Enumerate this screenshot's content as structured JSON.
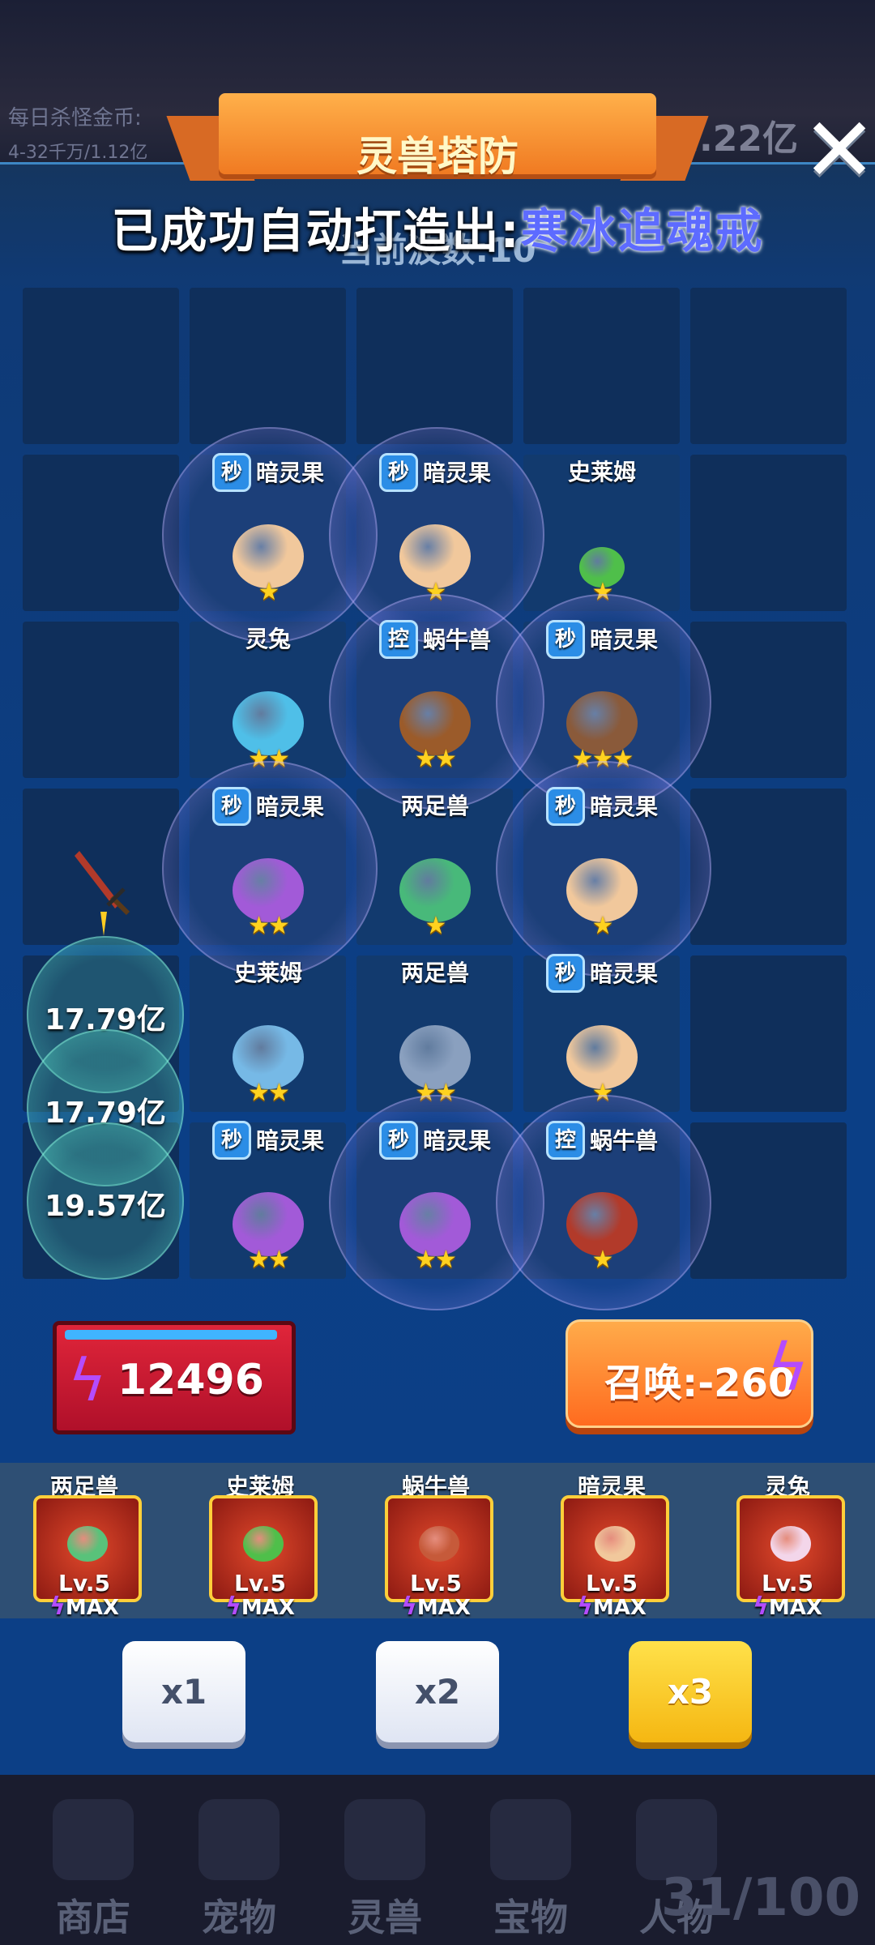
{
  "background": {
    "earnings_label": "每日杀怪金币:",
    "earnings_sub": "4-32千万/1.12亿",
    "gold_total": "2.22亿"
  },
  "header": {
    "title": "灵兽塔防",
    "wave_label": "当前波数:10",
    "toast_prefix": "已成功自动打造出:",
    "toast_item": "寒冰追魂戒"
  },
  "grid_units": [
    {
      "name": "暗灵果",
      "badge": "秒",
      "stars": "★",
      "color": "#f1c89c",
      "bubble": true
    },
    {
      "name": "暗灵果",
      "badge": "秒",
      "stars": "★",
      "color": "#f1c89c",
      "bubble": true
    },
    {
      "name": "史莱姆",
      "badge": "",
      "stars": "★",
      "color": "#4fbf4a",
      "bubble": false
    },
    {
      "name": "灵兔",
      "badge": "",
      "stars": "★★",
      "color": "#4fbfe8",
      "bubble": false
    },
    {
      "name": "蜗牛兽",
      "badge": "控",
      "stars": "★★",
      "color": "#9b5b2a",
      "bubble": true
    },
    {
      "name": "暗灵果",
      "badge": "秒",
      "stars": "★★★",
      "color": "#8a5a3a",
      "bubble": true
    },
    {
      "name": "暗灵果",
      "badge": "秒",
      "stars": "★★",
      "color": "#a25ad8",
      "bubble": true
    },
    {
      "name": "两足兽",
      "badge": "",
      "stars": "★",
      "color": "#48b97a",
      "bubble": false
    },
    {
      "name": "暗灵果",
      "badge": "秒",
      "stars": "★",
      "color": "#f1c89c",
      "bubble": true
    },
    {
      "name": "史莱姆",
      "badge": "",
      "stars": "★★",
      "color": "#76b9e6",
      "bubble": false
    },
    {
      "name": "两足兽",
      "badge": "",
      "stars": "★★",
      "color": "#8aa0bf",
      "bubble": false
    },
    {
      "name": "暗灵果",
      "badge": "秒",
      "stars": "★",
      "color": "#f1c89c",
      "bubble": false
    },
    {
      "name": "暗灵果",
      "badge": "秒",
      "stars": "★★",
      "color": "#a25ad8",
      "bubble": false
    },
    {
      "name": "暗灵果",
      "badge": "秒",
      "stars": "★★",
      "color": "#a25ad8",
      "bubble": true
    },
    {
      "name": "蜗牛兽",
      "badge": "控",
      "stars": "★",
      "color": "#b23a2a",
      "bubble": true
    }
  ],
  "damage": [
    "17.79亿",
    "17.79亿",
    "19.57亿"
  ],
  "energy": {
    "value": "12496"
  },
  "summon": {
    "label": "召唤:-260"
  },
  "upgrades": [
    {
      "name": "两足兽",
      "level": "Lv.5",
      "max": "MAX",
      "color": "#59c27a"
    },
    {
      "name": "史莱姆",
      "level": "Lv.5",
      "max": "MAX",
      "color": "#4fbf4a"
    },
    {
      "name": "蜗牛兽",
      "level": "Lv.5",
      "max": "MAX",
      "color": "#c65a3a"
    },
    {
      "name": "暗灵果",
      "level": "Lv.5",
      "max": "MAX",
      "color": "#f1c89c"
    },
    {
      "name": "灵兔",
      "level": "Lv.5",
      "max": "MAX",
      "color": "#f3d6ea"
    }
  ],
  "speed": [
    "x1",
    "x2",
    "x3"
  ],
  "nav": {
    "items": [
      "商店",
      "宠物",
      "灵兽",
      "宝物",
      "人物"
    ],
    "pages": "31/100"
  },
  "colors": {
    "accent": "#ff8a2a",
    "panel": "#0b3f86",
    "energy": "#d01c33",
    "star": "#ffd21f"
  }
}
